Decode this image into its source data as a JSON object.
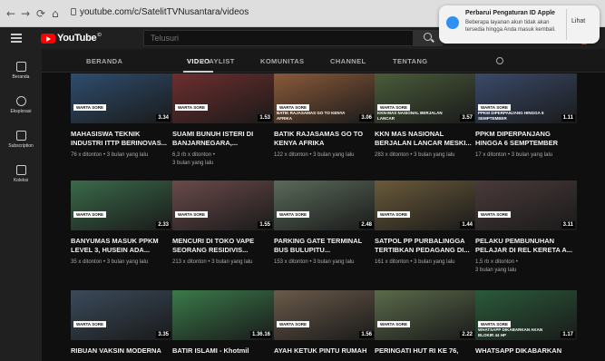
{
  "browser": {
    "url": "youtube.com/c/SatelitTVNusantara/videos"
  },
  "notification": {
    "title": "Perbarui Pengaturan ID Apple",
    "body": "Beberapa layanan akun tidak akan tersedia hingga Anda masuk kembali.",
    "action": "Lihat"
  },
  "header": {
    "logo": "YouTube",
    "logo_sup": "ID",
    "search_placeholder": "Telusuri"
  },
  "sidebar": [
    {
      "label": "Beranda",
      "icon": "home-icon"
    },
    {
      "label": "Eksplorasi",
      "icon": "compass-icon"
    },
    {
      "label": "Subscription",
      "icon": "subscriptions-icon"
    },
    {
      "label": "Koleksi",
      "icon": "library-icon"
    }
  ],
  "tabs": [
    "BERANDA",
    "VIDEO",
    "PLAYLIST",
    "KOMUNITAS",
    "CHANNEL",
    "TENTANG"
  ],
  "active_tab": "VIDEO",
  "videos": [
    {
      "title": "MAHASISWA TEKNIK INDUSTRI ITTP BERINOVAS...",
      "meta1": "76 x ditonton • 3 bulan yang lalu",
      "meta2": "",
      "duration": "3.34",
      "badge": "WARTA SORE",
      "headline": "",
      "color": "#2f4d6e"
    },
    {
      "title": "SUAMI BUNUH ISTERI DI BANJARNEGARA,...",
      "meta1": "6,3 rb x ditonton •",
      "meta2": "3 bulan yang lalu",
      "duration": "1.53",
      "badge": "WARTA SORE",
      "headline": "",
      "color": "#6e2e2e"
    },
    {
      "title": "BATIK RAJASAMAS GO TO KENYA AFRIKA",
      "meta1": "122 x ditonton • 3 bulan yang lalu",
      "meta2": "",
      "duration": "3.06",
      "badge": "WARTA SORE",
      "headline": "BATIK RAJASAMAS GO TO KENYA AFRIKA",
      "color": "#8a5a3a"
    },
    {
      "title": "KKN MAS NASIONAL BERJALAN LANCAR MESKI...",
      "meta1": "283 x ditonton • 3 bulan yang lalu",
      "meta2": "",
      "duration": "3.57",
      "badge": "WARTA SORE",
      "headline": "KKN-MAS NASIONAL BERJALAN LANCAR",
      "color": "#4a5c3a"
    },
    {
      "title": "PPKM DIPERPANJANG HINGGA 6 SEMPTEMBER",
      "meta1": "17 x ditonton • 3 bulan yang lalu",
      "meta2": "",
      "duration": "1.11",
      "badge": "WARTA SORE",
      "headline": "PPKM DIPERPANJANG HINGGA 6 SEMPTEMBER",
      "color": "#3a4a6a"
    },
    {
      "title": "BANYUMAS MASUK PPKM LEVEL 3, HUSEIN ADA...",
      "meta1": "35 x ditonton • 3 bulan yang lalu",
      "meta2": "",
      "duration": "2.33",
      "badge": "WARTA SORE",
      "headline": "",
      "color": "#3a6a4a"
    },
    {
      "title": "MENCURI DI TOKO VAPE SEORANG RESIDIVIS...",
      "meta1": "213 x ditonton • 3 bulan yang lalu",
      "meta2": "",
      "duration": "1.55",
      "badge": "WARTA SORE",
      "headline": "",
      "color": "#6a4a4a"
    },
    {
      "title": "PARKING GATE TERMINAL BUS BULUPITU...",
      "meta1": "153 x ditonton • 3 bulan yang lalu",
      "meta2": "",
      "duration": "2.48",
      "badge": "WARTA SORE",
      "headline": "",
      "color": "#5a6a5a"
    },
    {
      "title": "SATPOL PP PURBALINGGA TERTIBKAN PEDAGANG DI...",
      "meta1": "161 x ditonton • 3 bulan yang lalu",
      "meta2": "",
      "duration": "1.44",
      "badge": "WARTA SORE",
      "headline": "",
      "color": "#6a5a3a"
    },
    {
      "title": "PELAKU PEMBUNUHAN PELAJAR DI REL KERETA A...",
      "meta1": "1,5 rb x ditonton •",
      "meta2": "3 bulan yang lalu",
      "duration": "3.11",
      "badge": "WARTA SORE",
      "headline": "",
      "color": "#4a3a3a"
    },
    {
      "title": "RIBUAN VAKSIN MODERNA",
      "meta1": "",
      "meta2": "",
      "duration": "3.35",
      "badge": "WARTA SORE",
      "headline": "",
      "color": "#3a4a5a"
    },
    {
      "title": "BATIR ISLAMI - Khotmil",
      "meta1": "",
      "meta2": "",
      "duration": "1.36.16",
      "badge": "",
      "headline": "",
      "color": "#3a7a4a"
    },
    {
      "title": "AYAH KETUK PINTU RUMAH",
      "meta1": "",
      "meta2": "",
      "duration": "1.56",
      "badge": "WARTA SORE",
      "headline": "",
      "color": "#6a5a4a"
    },
    {
      "title": "PERINGATI HUT RI KE 76,",
      "meta1": "",
      "meta2": "",
      "duration": "2.22",
      "badge": "WARTA SORE",
      "headline": "",
      "color": "#5a6a4a"
    },
    {
      "title": "WHATSAPP DIKABARKAN",
      "meta1": "",
      "meta2": "",
      "duration": "1.17",
      "badge": "WARTA SORE",
      "headline": "WHATSAPP DIKABARKAN AKAN BLOKIR 44 HP",
      "color": "#2a5a3a"
    }
  ]
}
